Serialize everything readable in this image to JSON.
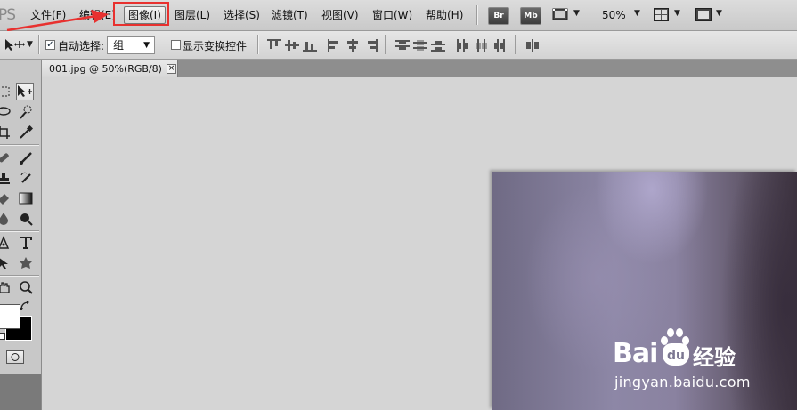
{
  "app": {
    "logo": "PS"
  },
  "menu": {
    "items": [
      {
        "label": "文件(F)"
      },
      {
        "label": "编辑(E)"
      },
      {
        "label": "图像(I)"
      },
      {
        "label": "图层(L)"
      },
      {
        "label": "选择(S)"
      },
      {
        "label": "滤镜(T)"
      },
      {
        "label": "视图(V)"
      },
      {
        "label": "窗口(W)"
      },
      {
        "label": "帮助(H)"
      }
    ],
    "bridge_label": "Br",
    "minibridge_label": "Mb",
    "zoom": "50%"
  },
  "options": {
    "auto_select_label": "自动选择:",
    "auto_select_checked": true,
    "auto_select_value": "组",
    "show_transform_label": "显示变换控件",
    "show_transform_checked": false
  },
  "document": {
    "tab_title": "001.jpg @ 50%(RGB/8)",
    "close_glyph": "×"
  },
  "watermark": {
    "bai": "Bai",
    "du": "du",
    "cn": "经验",
    "url": "jingyan.baidu.com"
  },
  "annotation": {
    "highlight_color": "#e8312f"
  }
}
